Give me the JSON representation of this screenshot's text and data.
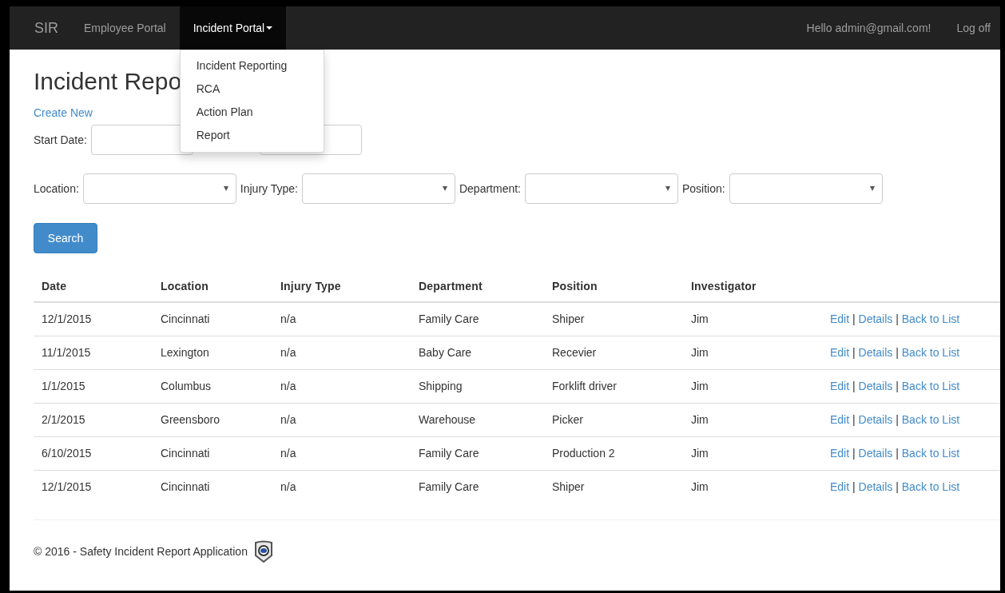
{
  "brand": "SIR",
  "nav": [
    {
      "label": "Employee Portal",
      "selected": false,
      "expanded": false
    },
    {
      "label": "Incident Portal",
      "selected": true,
      "expanded": true
    }
  ],
  "dropdown_items": [
    "Incident Reporting",
    "RCA",
    "Action Plan",
    "Report"
  ],
  "greeting": "Hello admin@gmail.com!",
  "logoff": "Log off",
  "title": "Incident Repo",
  "create_link": "Create New",
  "start_date_label": "Start Date:",
  "selects": [
    {
      "label": "Location:"
    },
    {
      "label": "Injury Type:"
    },
    {
      "label": "Department:"
    },
    {
      "label": "Position:"
    }
  ],
  "search_button": "Search",
  "table": {
    "columns": [
      "Date",
      "Location",
      "Injury Type",
      "Department",
      "Position",
      "Investigator"
    ],
    "rows": [
      {
        "cells": [
          "12/1/2015",
          "Cincinnati",
          "n/a",
          "Family Care",
          "Shiper",
          "Jim"
        ],
        "actions": [
          {
            "kind": "link",
            "text": "Edit"
          },
          {
            "kind": "separator",
            "text": "|"
          },
          {
            "kind": "link",
            "text": "Details"
          },
          {
            "kind": "separator",
            "text": "|"
          },
          {
            "kind": "link",
            "text": "Back to List"
          }
        ]
      },
      {
        "cells": [
          "11/1/2015",
          "Lexington",
          "n/a",
          "Baby Care",
          "Recevier",
          "Jim"
        ],
        "actions": [
          {
            "kind": "link",
            "text": "Edit"
          },
          {
            "kind": "separator",
            "text": "|"
          },
          {
            "kind": "link",
            "text": "Details"
          },
          {
            "kind": "separator",
            "text": "|"
          },
          {
            "kind": "link",
            "text": "Back to List"
          }
        ]
      },
      {
        "cells": [
          "1/1/2015",
          "Columbus",
          "n/a",
          "Shipping",
          "Forklift driver",
          "Jim"
        ],
        "actions": [
          {
            "kind": "link",
            "text": "Edit"
          },
          {
            "kind": "separator",
            "text": "|"
          },
          {
            "kind": "link",
            "text": "Details"
          },
          {
            "kind": "separator",
            "text": "|"
          },
          {
            "kind": "link",
            "text": "Back to List"
          }
        ]
      },
      {
        "cells": [
          "2/1/2015",
          "Greensboro",
          "n/a",
          "Warehouse",
          "Picker",
          "Jim"
        ],
        "actions": [
          {
            "kind": "link",
            "text": "Edit"
          },
          {
            "kind": "separator",
            "text": "|"
          },
          {
            "kind": "link",
            "text": "Details"
          },
          {
            "kind": "separator",
            "text": "|"
          },
          {
            "kind": "link",
            "text": "Back to List"
          }
        ]
      },
      {
        "cells": [
          "6/10/2015",
          "Cincinnati",
          "n/a",
          "Family Care",
          "Production 2",
          "Jim"
        ],
        "actions": [
          {
            "kind": "link",
            "text": "Edit"
          },
          {
            "kind": "separator",
            "text": "|"
          },
          {
            "kind": "link",
            "text": "Details"
          },
          {
            "kind": "separator",
            "text": "|"
          },
          {
            "kind": "link",
            "text": "Back to List"
          }
        ]
      },
      {
        "cells": [
          "12/1/2015",
          "Cincinnati",
          "n/a",
          "Family Care",
          "Shiper",
          "Jim"
        ],
        "actions": [
          {
            "kind": "link",
            "text": "Edit"
          },
          {
            "kind": "separator",
            "text": "|"
          },
          {
            "kind": "link",
            "text": "Details"
          },
          {
            "kind": "separator",
            "text": "|"
          },
          {
            "kind": "link",
            "text": "Back to List"
          }
        ]
      }
    ]
  },
  "footer": "© 2016 - Safety Incident Report Application"
}
